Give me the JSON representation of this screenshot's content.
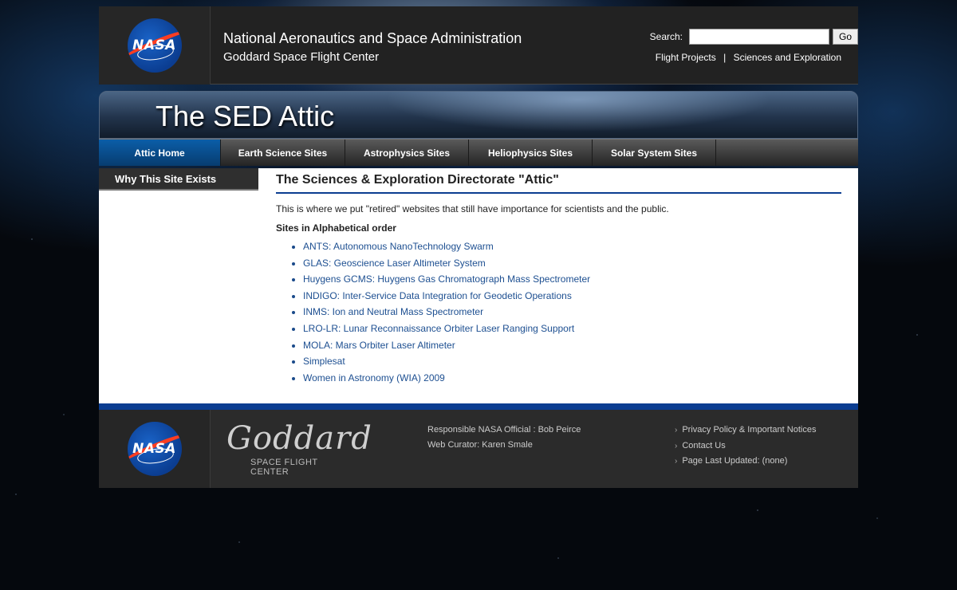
{
  "header": {
    "agency_name": "National Aeronautics and Space Administration",
    "center_name": "Goddard Space Flight Center",
    "logo_text": "NASA",
    "search_label": "Search:",
    "search_value": "",
    "go_label": "Go",
    "links": [
      "Flight Projects",
      "Sciences and Exploration"
    ],
    "link_separator": "|"
  },
  "banner": {
    "title": "The SED Attic"
  },
  "nav": {
    "items": [
      {
        "label": "Attic Home",
        "active": true
      },
      {
        "label": "Earth Science Sites",
        "active": false
      },
      {
        "label": "Astrophysics Sites",
        "active": false
      },
      {
        "label": "Heliophysics Sites",
        "active": false
      },
      {
        "label": "Solar System Sites",
        "active": false
      }
    ]
  },
  "sidebar": {
    "items": [
      "Why This Site Exists"
    ]
  },
  "main": {
    "heading": "The Sciences & Exploration Directorate \"Attic\"",
    "intro": "This is where we put \"retired\" websites that still have importance for scientists and the public.",
    "list_heading": "Sites in Alphabetical order",
    "sites": [
      "ANTS: Autonomous NanoTechnology Swarm",
      "GLAS: Geoscience Laser Altimeter System",
      "Huygens GCMS: Huygens Gas Chromatograph Mass Spectrometer",
      "INDIGO: Inter-Service Data Integration for Geodetic Operations",
      "INMS: Ion and Neutral Mass Spectrometer",
      "LRO-LR: Lunar Reconnaissance Orbiter Laser Ranging Support",
      "MOLA: Mars Orbiter Laser Altimeter",
      "Simplesat",
      "Women in Astronomy (WIA) 2009"
    ]
  },
  "footer": {
    "logo_text": "NASA",
    "goddard_script": "Goddard",
    "goddard_sub": "SPACE FLIGHT CENTER",
    "official": "Responsible NASA Official : Bob Peirce",
    "curator": "Web Curator: Karen Smale",
    "links": [
      "Privacy Policy & Important Notices",
      "Contact Us",
      "Page Last Updated: (none)"
    ]
  },
  "colors": {
    "nasa_blue": "#0b3d91",
    "link": "#1d4f91",
    "nav_active": "#0b5ea8"
  }
}
